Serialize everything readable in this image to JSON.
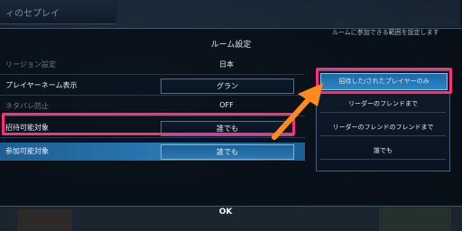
{
  "top_ghost_label": "ィのセプレイ",
  "panel": {
    "title": "ルーム設定",
    "subtitle": "ルームに参加できる範囲を設定します",
    "rows": [
      {
        "label": "リージョン設定",
        "value": "日本",
        "dim": true
      },
      {
        "label": "プレイヤーネーム表示",
        "value": "グラン"
      },
      {
        "label": "ネタバレ防止",
        "value": "OFF",
        "dim": true
      },
      {
        "label": "招待可能対象",
        "value": "誰でも"
      },
      {
        "label": "参加可能対象",
        "value": "誰でも",
        "active": true
      }
    ],
    "ok_label": "OK"
  },
  "dropdown": {
    "options": [
      {
        "label": "招待した/されたプレイヤーのみ",
        "selected": true
      },
      {
        "label": "リーダーのフレンドまで"
      },
      {
        "label": "リーダーのフレンドのフレンドまで"
      },
      {
        "label": "誰でも"
      }
    ]
  },
  "colors": {
    "highlight": "#ff2f7a",
    "arrow": "#ff8a1f",
    "accent": "#2a78b3"
  }
}
